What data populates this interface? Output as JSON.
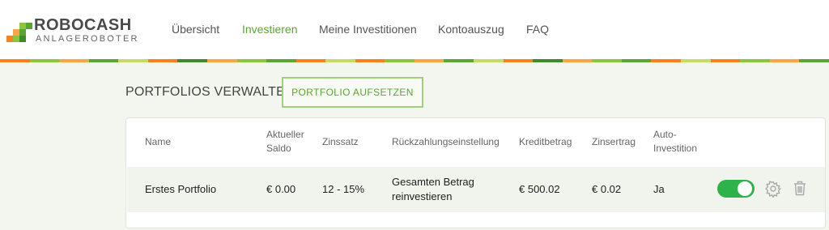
{
  "brand": {
    "name": "ROBOCASH",
    "tagline": "ANLAGEROBOTER"
  },
  "nav": [
    {
      "label": "Übersicht",
      "active": false
    },
    {
      "label": "Investieren",
      "active": true
    },
    {
      "label": "Meine Investitionen",
      "active": false
    },
    {
      "label": "Kontoauszug",
      "active": false
    },
    {
      "label": "FAQ",
      "active": false
    }
  ],
  "page": {
    "title": "PORTFOLIOS VERWALTEN",
    "create_button": "PORTFOLIO AUFSETZEN"
  },
  "table": {
    "headers": {
      "name": "Name",
      "saldo_line1": "Aktueller",
      "saldo_line2": "Saldo",
      "zinssatz": "Zinssatz",
      "rueckzahlung": "Rückzahlungseinstellung",
      "kreditbetrag": "Kreditbetrag",
      "zinsertrag": "Zinsertrag",
      "auto_line1": "Auto-",
      "auto_line2": "Investition"
    },
    "rows": [
      {
        "name": "Erstes Portfolio",
        "saldo": "€ 0.00",
        "zinssatz": "12 - 15%",
        "rueckzahlung_line1": "Gesamten Betrag",
        "rueckzahlung_line2": "reinvestieren",
        "kreditbetrag": "€ 500.02",
        "zinsertrag": "€ 0.02",
        "auto": "Ja",
        "enabled": true
      }
    ]
  },
  "colors": {
    "accent": "#5aa632",
    "toggle_on": "#2db34a",
    "stripe_orange": "#f58220",
    "stripe_green": "#6ab04c"
  },
  "icons": {
    "settings": "gear-icon",
    "delete": "trash-icon"
  }
}
